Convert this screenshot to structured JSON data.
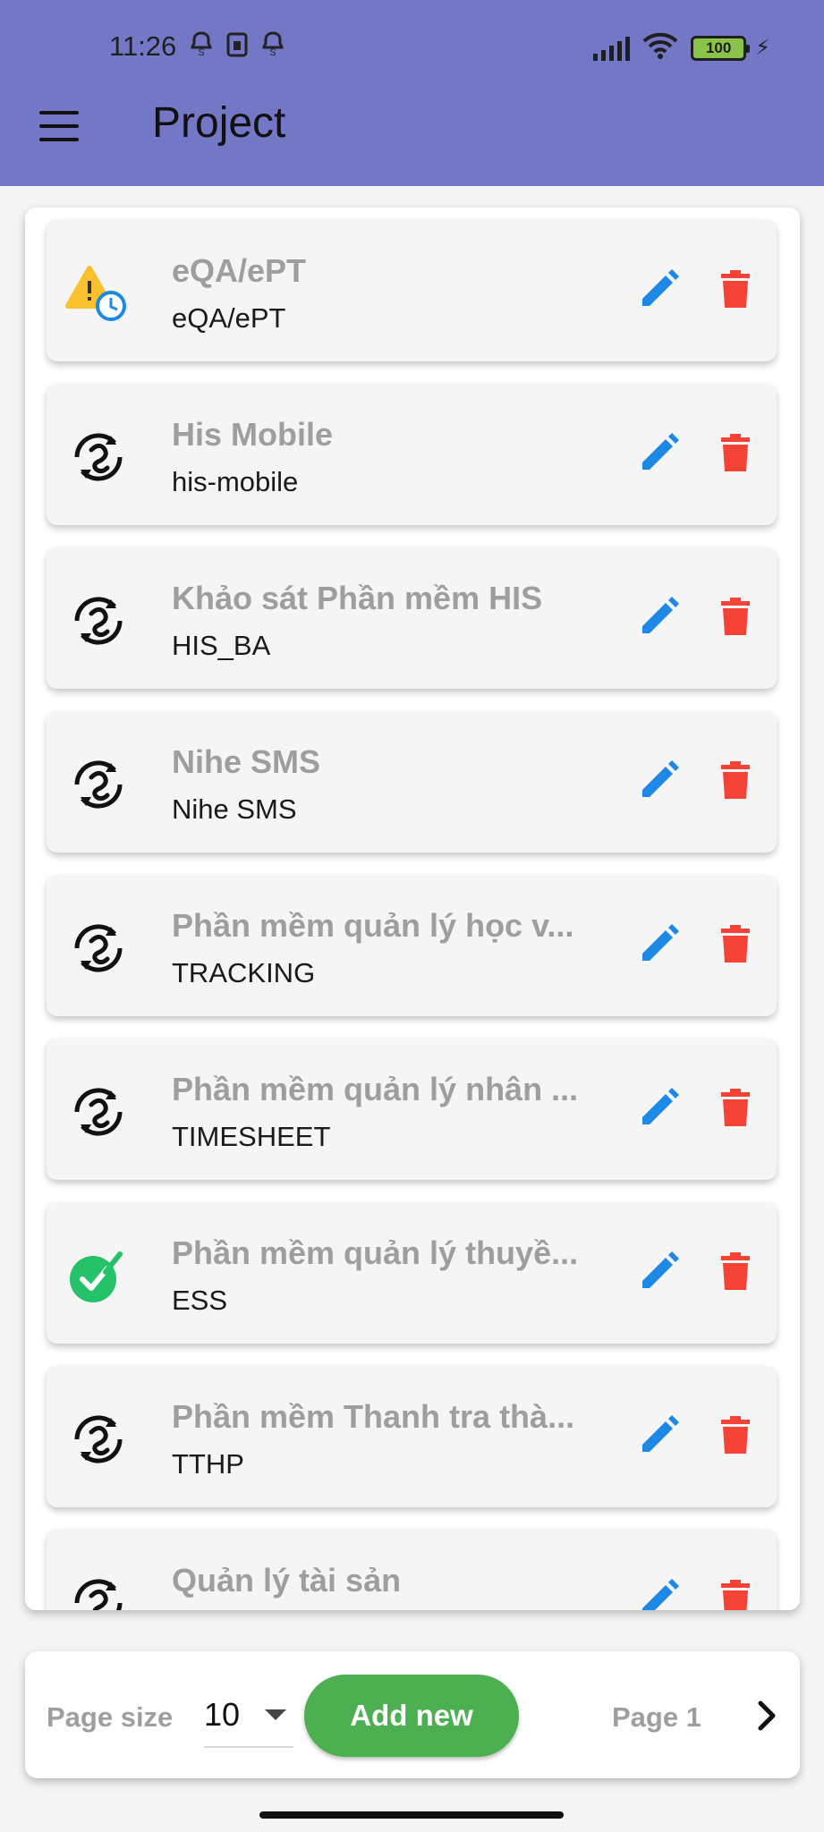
{
  "status_bar": {
    "time": "11:26",
    "battery": "100",
    "icons": [
      "notification-icon",
      "sim-icon",
      "notification-icon",
      "signal-icon",
      "wifi-icon",
      "battery-icon",
      "charging-icon"
    ]
  },
  "app_bar": {
    "title": "Project",
    "menu_icon": "menu-icon",
    "background": "#7477c6"
  },
  "projects": [
    {
      "name": "eQA/ePT",
      "code": "eQA/ePT",
      "status_icon": "warning-clock-icon"
    },
    {
      "name": "His Mobile",
      "code": "his-mobile",
      "status_icon": "sync-icon"
    },
    {
      "name": "Khảo sát Phần mềm HIS",
      "code": "HIS_BA",
      "status_icon": "sync-icon"
    },
    {
      "name": "Nihe SMS",
      "code": "Nihe SMS",
      "status_icon": "sync-icon"
    },
    {
      "name": "Phần mềm quản lý học v...",
      "code": "TRACKING",
      "status_icon": "sync-icon"
    },
    {
      "name": "Phần mềm quản lý nhân ...",
      "code": "TIMESHEET",
      "status_icon": "sync-icon"
    },
    {
      "name": "Phần mềm quản lý thuyề...",
      "code": "ESS",
      "status_icon": "check-circle-icon"
    },
    {
      "name": "Phần mềm Thanh tra thà...",
      "code": "TTHP",
      "status_icon": "sync-icon"
    },
    {
      "name": "Quản lý tài sản",
      "code": "",
      "status_icon": "sync-icon"
    }
  ],
  "actions": {
    "edit_icon": "pencil-icon",
    "delete_icon": "trash-icon",
    "edit_color": "#1e88e5",
    "delete_color": "#f44336"
  },
  "footer": {
    "page_size_label": "Page size",
    "page_size_value": "10",
    "add_new_label": "Add new",
    "page_label": "Page 1",
    "next_icon": "chevron-right-icon",
    "accent": "#4caf50"
  }
}
